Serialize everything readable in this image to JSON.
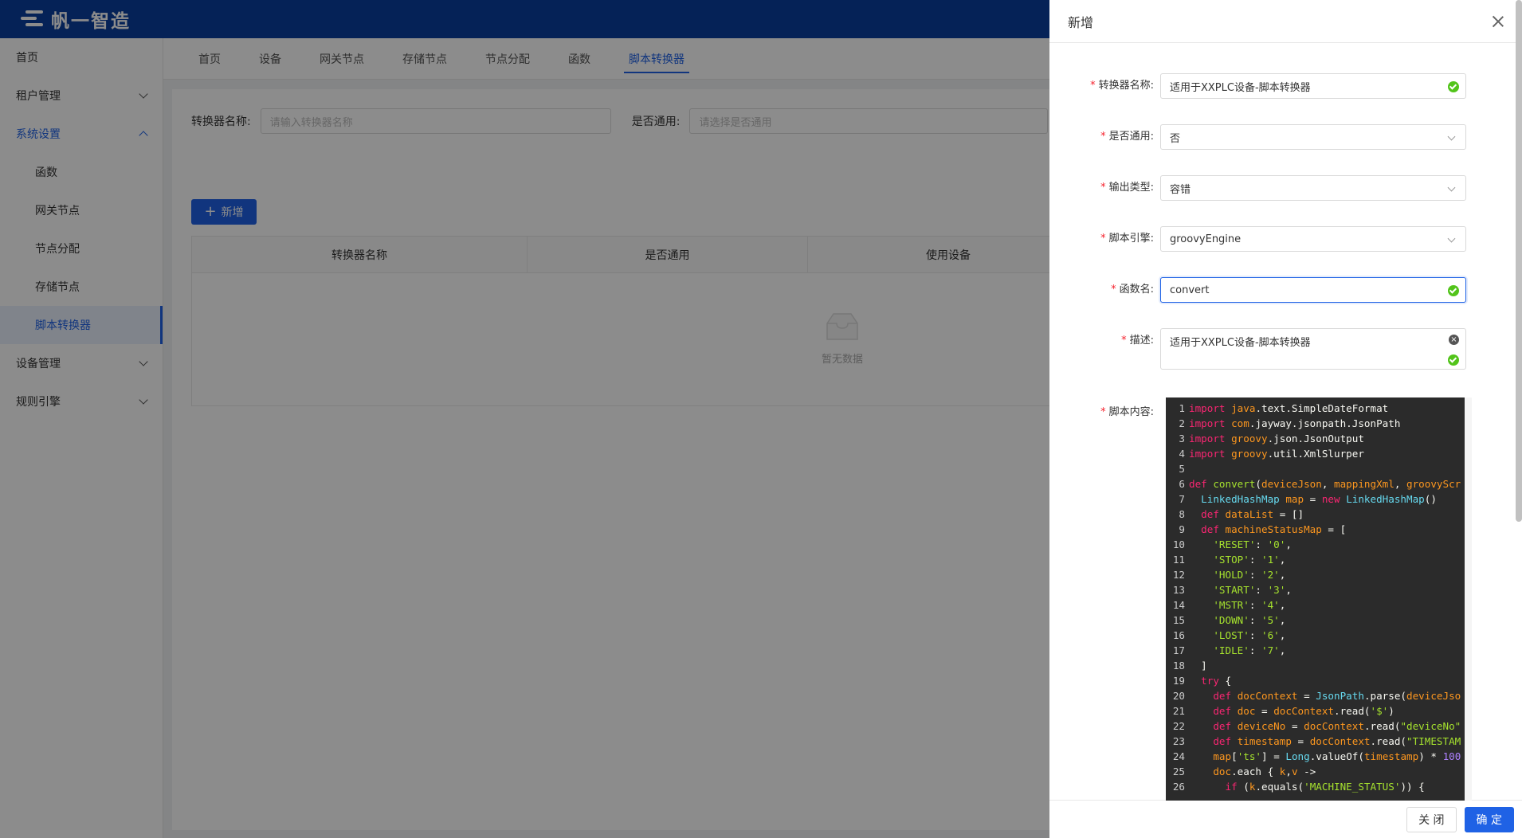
{
  "app": {
    "logo_text": "帆一智造"
  },
  "sidebar": {
    "items": [
      {
        "label": "首页"
      },
      {
        "label": "租户管理"
      },
      {
        "label": "系统设置"
      },
      {
        "label": "函数"
      },
      {
        "label": "网关节点"
      },
      {
        "label": "节点分配"
      },
      {
        "label": "存储节点"
      },
      {
        "label": "脚本转换器"
      },
      {
        "label": "设备管理"
      },
      {
        "label": "规则引擎"
      }
    ]
  },
  "tabs": [
    {
      "label": "首页"
    },
    {
      "label": "设备"
    },
    {
      "label": "网关节点"
    },
    {
      "label": "存储节点"
    },
    {
      "label": "节点分配"
    },
    {
      "label": "函数"
    },
    {
      "label": "脚本转换器"
    }
  ],
  "search": {
    "name_label": "转换器名称:",
    "name_placeholder": "请输入转换器名称",
    "common_label": "是否通用:",
    "common_placeholder": "请选择是否通用"
  },
  "toolbar": {
    "add_label": "新增"
  },
  "table": {
    "columns": [
      "转换器名称",
      "是否通用",
      "使用设备"
    ],
    "empty_text": "暂无数据"
  },
  "drawer": {
    "title": "新增",
    "fields": {
      "name": {
        "label": "转换器名称:",
        "value": "适用于XXPLC设备-脚本转换器"
      },
      "common": {
        "label": "是否通用:",
        "value": "否"
      },
      "output": {
        "label": "输出类型:",
        "value": "容错"
      },
      "engine": {
        "label": "脚本引擎:",
        "value": "groovyEngine"
      },
      "func": {
        "label": "函数名:",
        "value": "convert"
      },
      "desc": {
        "label": "描述:",
        "value": "适用于XXPLC设备-脚本转换器"
      },
      "script": {
        "label": "脚本内容:"
      }
    },
    "cancel_label": "关 闭",
    "ok_label": "确 定"
  },
  "code_lines": [
    {
      "n": "1",
      "t": [
        [
          "kw",
          "import"
        ],
        [
          "pl",
          " "
        ],
        [
          "pk",
          "java"
        ],
        [
          "pl",
          ".text.SimpleDateFormat"
        ]
      ]
    },
    {
      "n": "2",
      "t": [
        [
          "kw",
          "import"
        ],
        [
          "pl",
          " "
        ],
        [
          "pk",
          "com"
        ],
        [
          "pl",
          ".jayway.jsonpath.JsonPath"
        ]
      ]
    },
    {
      "n": "3",
      "t": [
        [
          "kw",
          "import"
        ],
        [
          "pl",
          " "
        ],
        [
          "pk",
          "groovy"
        ],
        [
          "pl",
          ".json.JsonOutput"
        ]
      ]
    },
    {
      "n": "4",
      "t": [
        [
          "kw",
          "import"
        ],
        [
          "pl",
          " "
        ],
        [
          "pk",
          "groovy"
        ],
        [
          "pl",
          ".util.XmlSlurper"
        ]
      ]
    },
    {
      "n": "5",
      "t": []
    },
    {
      "n": "6",
      "t": [
        [
          "kw",
          "def"
        ],
        [
          "pl",
          " "
        ],
        [
          "fn",
          "convert"
        ],
        [
          "pl",
          "("
        ],
        [
          "pk",
          "deviceJson"
        ],
        [
          "pl",
          ", "
        ],
        [
          "pk",
          "mappingXml"
        ],
        [
          "pl",
          ", "
        ],
        [
          "pk",
          "groovyScr"
        ]
      ]
    },
    {
      "n": "7",
      "t": [
        [
          "pl",
          "  "
        ],
        [
          "ty",
          "LinkedHashMap"
        ],
        [
          "pl",
          " "
        ],
        [
          "pk",
          "map"
        ],
        [
          "pl",
          " = "
        ],
        [
          "kw",
          "new"
        ],
        [
          "pl",
          " "
        ],
        [
          "ty",
          "LinkedHashMap"
        ],
        [
          "pl",
          "()"
        ]
      ]
    },
    {
      "n": "8",
      "t": [
        [
          "pl",
          "  "
        ],
        [
          "kw",
          "def"
        ],
        [
          "pl",
          " "
        ],
        [
          "pk",
          "dataList"
        ],
        [
          "pl",
          " = []"
        ]
      ]
    },
    {
      "n": "9",
      "t": [
        [
          "pl",
          "  "
        ],
        [
          "kw",
          "def"
        ],
        [
          "pl",
          " "
        ],
        [
          "pk",
          "machineStatusMap"
        ],
        [
          "pl",
          " = ["
        ]
      ]
    },
    {
      "n": "10",
      "t": [
        [
          "pl",
          "    "
        ],
        [
          "st",
          "'RESET'"
        ],
        [
          "pl",
          ": "
        ],
        [
          "st",
          "'0'"
        ],
        [
          "pl",
          ","
        ]
      ]
    },
    {
      "n": "11",
      "t": [
        [
          "pl",
          "    "
        ],
        [
          "st",
          "'STOP'"
        ],
        [
          "pl",
          ": "
        ],
        [
          "st",
          "'1'"
        ],
        [
          "pl",
          ","
        ]
      ]
    },
    {
      "n": "12",
      "t": [
        [
          "pl",
          "    "
        ],
        [
          "st",
          "'HOLD'"
        ],
        [
          "pl",
          ": "
        ],
        [
          "st",
          "'2'"
        ],
        [
          "pl",
          ","
        ]
      ]
    },
    {
      "n": "13",
      "t": [
        [
          "pl",
          "    "
        ],
        [
          "st",
          "'START'"
        ],
        [
          "pl",
          ": "
        ],
        [
          "st",
          "'3'"
        ],
        [
          "pl",
          ","
        ]
      ]
    },
    {
      "n": "14",
      "t": [
        [
          "pl",
          "    "
        ],
        [
          "st",
          "'MSTR'"
        ],
        [
          "pl",
          ": "
        ],
        [
          "st",
          "'4'"
        ],
        [
          "pl",
          ","
        ]
      ]
    },
    {
      "n": "15",
      "t": [
        [
          "pl",
          "    "
        ],
        [
          "st",
          "'DOWN'"
        ],
        [
          "pl",
          ": "
        ],
        [
          "st",
          "'5'"
        ],
        [
          "pl",
          ","
        ]
      ]
    },
    {
      "n": "16",
      "t": [
        [
          "pl",
          "    "
        ],
        [
          "st",
          "'LOST'"
        ],
        [
          "pl",
          ": "
        ],
        [
          "st",
          "'6'"
        ],
        [
          "pl",
          ","
        ]
      ]
    },
    {
      "n": "17",
      "t": [
        [
          "pl",
          "    "
        ],
        [
          "st",
          "'IDLE'"
        ],
        [
          "pl",
          ": "
        ],
        [
          "st",
          "'7'"
        ],
        [
          "pl",
          ","
        ]
      ]
    },
    {
      "n": "18",
      "t": [
        [
          "pl",
          "  ]"
        ]
      ]
    },
    {
      "n": "19",
      "t": [
        [
          "pl",
          "  "
        ],
        [
          "kw",
          "try"
        ],
        [
          "pl",
          " {"
        ]
      ]
    },
    {
      "n": "20",
      "t": [
        [
          "pl",
          "    "
        ],
        [
          "kw",
          "def"
        ],
        [
          "pl",
          " "
        ],
        [
          "pk",
          "docContext"
        ],
        [
          "pl",
          " = "
        ],
        [
          "ty",
          "JsonPath"
        ],
        [
          "pl",
          ".parse("
        ],
        [
          "pk",
          "deviceJso"
        ]
      ]
    },
    {
      "n": "21",
      "t": [
        [
          "pl",
          "    "
        ],
        [
          "kw",
          "def"
        ],
        [
          "pl",
          " "
        ],
        [
          "pk",
          "doc"
        ],
        [
          "pl",
          " = "
        ],
        [
          "pk",
          "docContext"
        ],
        [
          "pl",
          ".read("
        ],
        [
          "st",
          "'$'"
        ],
        [
          "pl",
          ")"
        ]
      ]
    },
    {
      "n": "22",
      "t": [
        [
          "pl",
          "    "
        ],
        [
          "kw",
          "def"
        ],
        [
          "pl",
          " "
        ],
        [
          "pk",
          "deviceNo"
        ],
        [
          "pl",
          " = "
        ],
        [
          "pk",
          "docContext"
        ],
        [
          "pl",
          ".read("
        ],
        [
          "st",
          "\"deviceNo\""
        ]
      ]
    },
    {
      "n": "23",
      "t": [
        [
          "pl",
          "    "
        ],
        [
          "kw",
          "def"
        ],
        [
          "pl",
          " "
        ],
        [
          "pk",
          "timestamp"
        ],
        [
          "pl",
          " = "
        ],
        [
          "pk",
          "docContext"
        ],
        [
          "pl",
          ".read("
        ],
        [
          "st",
          "\"TIMESTAM"
        ]
      ]
    },
    {
      "n": "24",
      "t": [
        [
          "pl",
          "    "
        ],
        [
          "pk",
          "map"
        ],
        [
          "pl",
          "["
        ],
        [
          "st",
          "'ts'"
        ],
        [
          "pl",
          "] = "
        ],
        [
          "ty",
          "Long"
        ],
        [
          "pl",
          ".valueOf("
        ],
        [
          "pk",
          "timestamp"
        ],
        [
          "pl",
          ") * "
        ],
        [
          "nu",
          "100"
        ]
      ]
    },
    {
      "n": "25",
      "t": [
        [
          "pl",
          "    "
        ],
        [
          "pk",
          "doc"
        ],
        [
          "pl",
          ".each { "
        ],
        [
          "pk",
          "k"
        ],
        [
          "pl",
          ","
        ],
        [
          "pk",
          "v"
        ],
        [
          "pl",
          " ->"
        ]
      ]
    },
    {
      "n": "26",
      "t": [
        [
          "pl",
          "      "
        ],
        [
          "kw",
          "if"
        ],
        [
          "pl",
          " ("
        ],
        [
          "pk",
          "k"
        ],
        [
          "pl",
          ".equals("
        ],
        [
          "st",
          "'MACHINE_STATUS'"
        ],
        [
          "pl",
          ")) {"
        ]
      ]
    }
  ],
  "code_colors": {
    "kw": "#f92672",
    "pk": "#fd971f",
    "fn": "#a6e22e",
    "ty": "#66d9ef",
    "st": "#a6e22e",
    "nu": "#ae81ff",
    "pl": "#f8f8f2"
  }
}
